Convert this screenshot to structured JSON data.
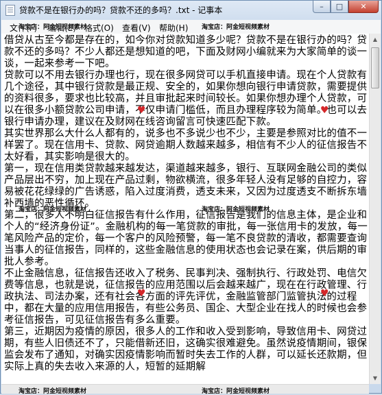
{
  "window": {
    "title": "贷款不是在银行办的吗？贷款不还的多吗？.txt - 记事本",
    "controls": {
      "minimize": "–",
      "maximize": "□",
      "close": "✕"
    }
  },
  "menu": [
    "文件(F)",
    "编辑(E)",
    "格式(O)",
    "查看(V)",
    "帮助(H)"
  ],
  "watermark": "淘宝店：阿金短视频素材",
  "content": {
    "text": "借贷从古至今都是存在的，如今你对贷款知道多少呢？贷款不是在银行办的吗？贷款不还的多吗？不少人都还是想知道的吧，下面及财网小编就来为大家简单的谈一谈，一起来参考一下吧。\n贷款可以不用去银行办理也行，现在很多网贷可以手机直接申请。现在个人贷款有几个途径，其中银行贷款是最正规、安全的，如果你想向银行申请贷款，需要提供的资料很多，要求也比较高，并且审批起来时间较长。如果你想办理个人贷款，可以在很多小额贷款公司申请，不仅申请门槛低，而且办理程序较为简单。也可以去银行申请办理，建议在及财网在线咨询留言可快速匹配下款。\n其实世界那么大什么人都有的，说多也不多说少也不少，主要是参照对比的值不一样罢了。现在信用卡、贷款、网贷逾期人数越来越多，相信有不少人的征信报告不太好看，其实影响是很大的。\n第一，现在信用类贷款越来越发达，渠道越来越多，银行、互联网金融公司的类似产品层出不穷，加上现在产品过剩，物欲横流，很多年轻人没有足够的自控力，容易被花花绿绿的广告诱惑，陷入过度消费，透支未来，又因为过度透支不断拆东墙补西墙的恶性循环。\n第二，很多人不明白征信报告有什么作用，征信报告是我们的信息主体，是企业和个人的“经济身份证”。金融机构的每一笔贷款的审批，每一张信用卡的发放，每一笔风险产品的定价，每一个客户的风险预警，每一笔不良贷款的清收，都需要查询当事人的征信报告，同样的，这些金融信息的使用状态也会记录在案，供后期的审批人参考。\n不止金融信息，征信报告还收入了税务、民事判决、强制执行、行政处罚、电信欠费等信息，也就是说，征信报告的应用范围以后会越来越广，现在在行政管理、行政执法、司法办案，还有社会各方面的评先评优，金融监管部门监管执法的过程中，都在大量的应用信用报告，有些公务员、国企、大型企业在找人的时候也会参考征信报告，可见征信报告有多么重要。\n第三，近期因为疫情的原因，很多人的工作和收入受到影响，导致信用卡、网贷过期，有些人旧债还不了，只能借新还旧，这确实很难避免。虽然说疫情期间，银保监会发布了通知，对确实因疫情影响而暂时失去工作的人群，可以延长还款期，但实际上真的失去收入来源的人，短暂的延期解"
  }
}
